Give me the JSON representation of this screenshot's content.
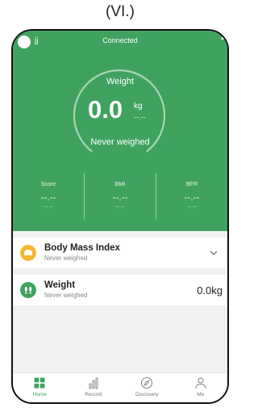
{
  "caption": "(VI.)",
  "header": {
    "username": "jj",
    "connection_status": "Connected",
    "more_icon": "more-dots-icon"
  },
  "weight_panel": {
    "label": "Weight",
    "value": "0.0",
    "unit": "kg",
    "sub_value": "--.--",
    "status": "Never weighed"
  },
  "metrics": [
    {
      "label": "Score",
      "value": "--.--",
      "sub": "--.--"
    },
    {
      "label": "BMI",
      "value": "--.--",
      "sub": "--.--"
    },
    {
      "label": "BFR",
      "value": "--.--",
      "sub": "--.--"
    }
  ],
  "cards": {
    "bmi": {
      "title": "Body Mass Index",
      "subtitle": "Never weighed",
      "icon": "bmi-icon",
      "icon_color": "#f4b72f"
    },
    "weight": {
      "title": "Weight",
      "subtitle": "Never weighed",
      "value": "0.0kg",
      "icon": "footprint-icon",
      "icon_color": "#3fa35f"
    }
  },
  "tabbar": {
    "items": [
      {
        "label": "Home",
        "icon": "home-grid-icon",
        "active": true
      },
      {
        "label": "Record",
        "icon": "bar-chart-icon",
        "active": false
      },
      {
        "label": "Discovery",
        "icon": "compass-icon",
        "active": false
      },
      {
        "label": "Me",
        "icon": "person-icon",
        "active": false
      }
    ]
  },
  "colors": {
    "primary_green": "#3fa35f",
    "bmi_yellow": "#f4b72f",
    "background": "#f1f1f1"
  }
}
